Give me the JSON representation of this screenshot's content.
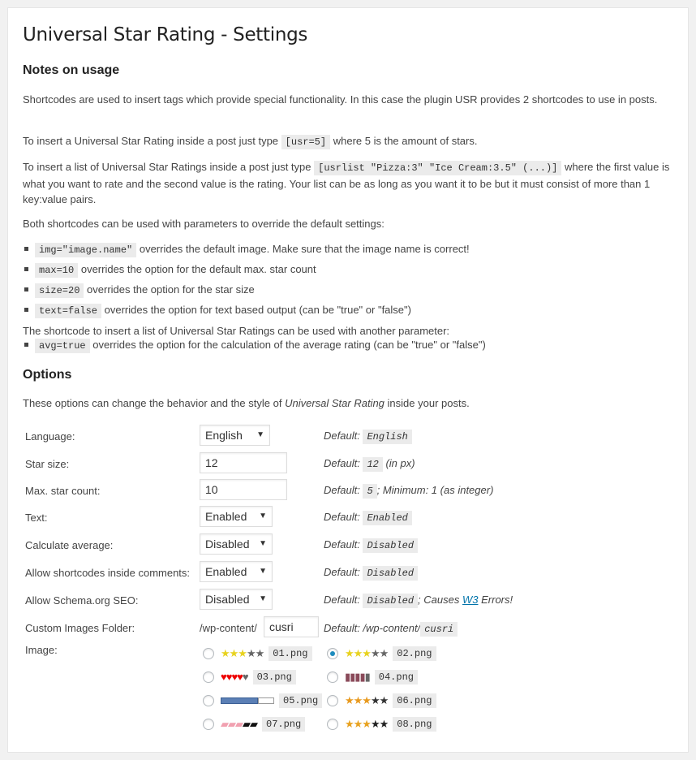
{
  "page_title": "Universal Star Rating - Settings",
  "notes": {
    "heading": "Notes on usage",
    "p1": "Shortcodes are used to insert tags which provide special functionality. In this case the plugin USR provides 2 shortcodes to use in posts.",
    "p2_before": "To insert a Universal Star Rating inside a post just type",
    "p2_code": "[usr=5]",
    "p2_after": "where 5 is the amount of stars.",
    "p3_before": "To insert a list of Universal Star Ratings inside a post just type",
    "p3_code": "[usrlist \"Pizza:3\" \"Ice Cream:3.5\" (...)]",
    "p3_after": "where the first value is what you want to rate and the second value is the rating. Your list can be as long as you want it to be but it must consist of more than 1 key:value pairs.",
    "p4": "Both shortcodes can be used with parameters to override the default settings:",
    "params": [
      {
        "code": "img=\"image.name\"",
        "text": "overrides the default image. Make sure that the image name is correct!"
      },
      {
        "code": "max=10",
        "text": "overrides the option for the default max. star count"
      },
      {
        "code": "size=20",
        "text": "overrides the option for the star size"
      },
      {
        "code": "text=false",
        "text": "overrides the option for text based output (can be \"true\" or \"false\")"
      }
    ],
    "p5": "The shortcode to insert a list of Universal Star Ratings can be used with another parameter:",
    "list_param": {
      "code": "avg=true",
      "text": "overrides the option for the calculation of the average rating (can be \"true\" or \"false\")"
    }
  },
  "options": {
    "heading": "Options",
    "intro_before": "These options can change the behavior and the style of",
    "intro_em": "Universal Star Rating",
    "intro_after": "inside your posts.",
    "default_label": "Default:",
    "language": {
      "label": "Language:",
      "value": "English",
      "default": "English"
    },
    "star_size": {
      "label": "Star size:",
      "value": "12",
      "default": "12",
      "suffix": "(in px)"
    },
    "max_star": {
      "label": "Max. star count:",
      "value": "10",
      "default": "5",
      "suffix": "; Minimum: 1 (as integer)"
    },
    "text": {
      "label": "Text:",
      "value": "Enabled",
      "default": "Enabled"
    },
    "calc_avg": {
      "label": "Calculate average:",
      "value": "Disabled",
      "default": "Disabled"
    },
    "allow_comments": {
      "label": "Allow shortcodes inside comments:",
      "value": "Enabled",
      "default": "Disabled"
    },
    "schema": {
      "label": "Allow Schema.org SEO:",
      "value": "Disabled",
      "default": "Disabled",
      "suffix_before": "; Causes",
      "link": "W3",
      "suffix_after": "Errors!"
    },
    "images_folder": {
      "label": "Custom Images Folder:",
      "prefix": "/wp-content/",
      "value": "cusri",
      "default_prefix": "Default: /wp-content/",
      "default": "cusri"
    },
    "image": {
      "label": "Image:",
      "choices": [
        {
          "file": "01.png",
          "selected": false
        },
        {
          "file": "02.png",
          "selected": true
        },
        {
          "file": "03.png",
          "selected": false
        },
        {
          "file": "04.png",
          "selected": false
        },
        {
          "file": "05.png",
          "selected": false
        },
        {
          "file": "06.png",
          "selected": false
        },
        {
          "file": "07.png",
          "selected": false
        },
        {
          "file": "08.png",
          "selected": false
        }
      ]
    }
  },
  "colors": {
    "accent": "#1e8cbe",
    "link": "#0073aa",
    "code_bg": "#ebebeb"
  }
}
